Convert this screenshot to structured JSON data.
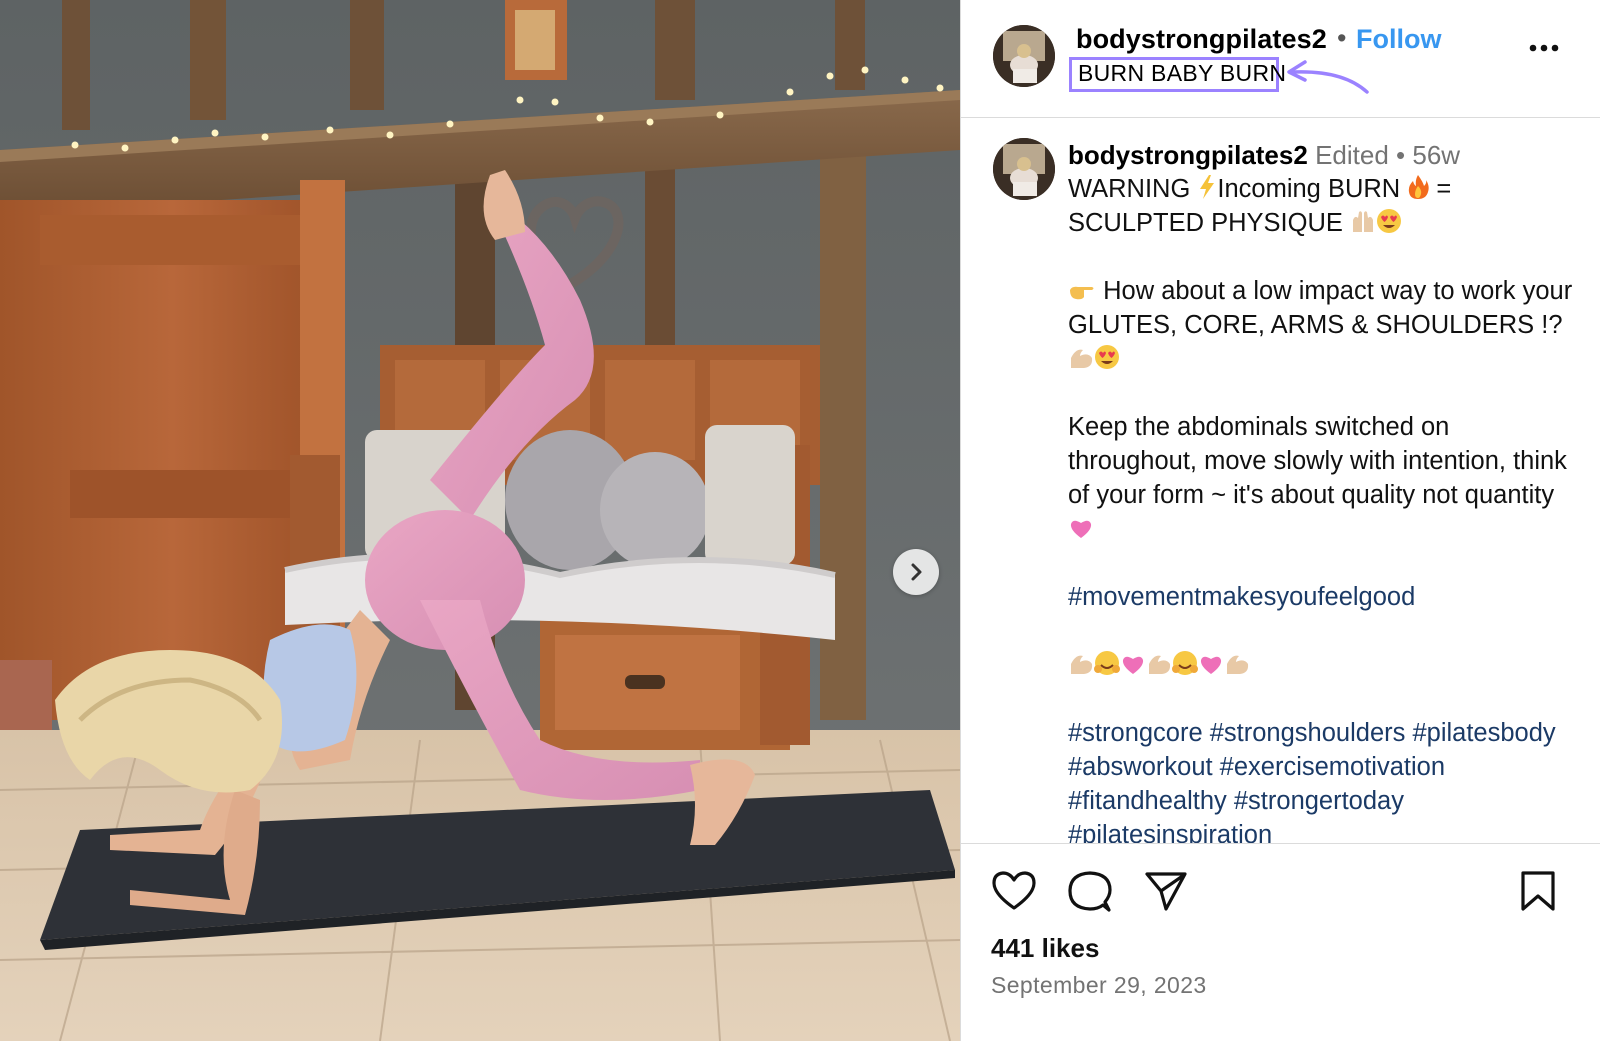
{
  "post": {
    "username": "bodystrongpilates2",
    "follow_label": "Follow",
    "separator_dot": "•",
    "audio_label": "BURN BABY BURN",
    "more_icon": "more-horizontal-icon",
    "next_icon": "chevron-right-icon"
  },
  "caption": {
    "username": "bodystrongpilates2",
    "edited": "Edited",
    "dot": "•",
    "age": "56w",
    "line1": "WARNING ",
    "line1b": "Incoming BURN ",
    "line1c": " =",
    "line2": "SCULPTED PHYSIQUE ",
    "para2a": "How about a low impact way to work your GLUTES, CORE, ARMS & SHOULDERS !?",
    "para3": "Keep the abdominals switched on throughout, move slowly with intention, think of your form ~ it's about quality not quantity ",
    "hashtag1": "#movementmakesyoufeelgood",
    "hashtags2": "#strongcore #strongshoulders #pilatesbody #absworkout #exercisemotivation #fitandhealthy #strongertoday #pilatesinspiration"
  },
  "actions": {
    "like_icon": "heart-icon",
    "comment_icon": "comment-icon",
    "share_icon": "paper-plane-icon",
    "save_icon": "bookmark-icon"
  },
  "likes_text": "441 likes",
  "date_text": "September 29, 2023",
  "colors": {
    "follow": "#3897f0",
    "highlight_box": "#9b82ff",
    "hashtag": "#1b3a66",
    "muted": "#737373"
  }
}
